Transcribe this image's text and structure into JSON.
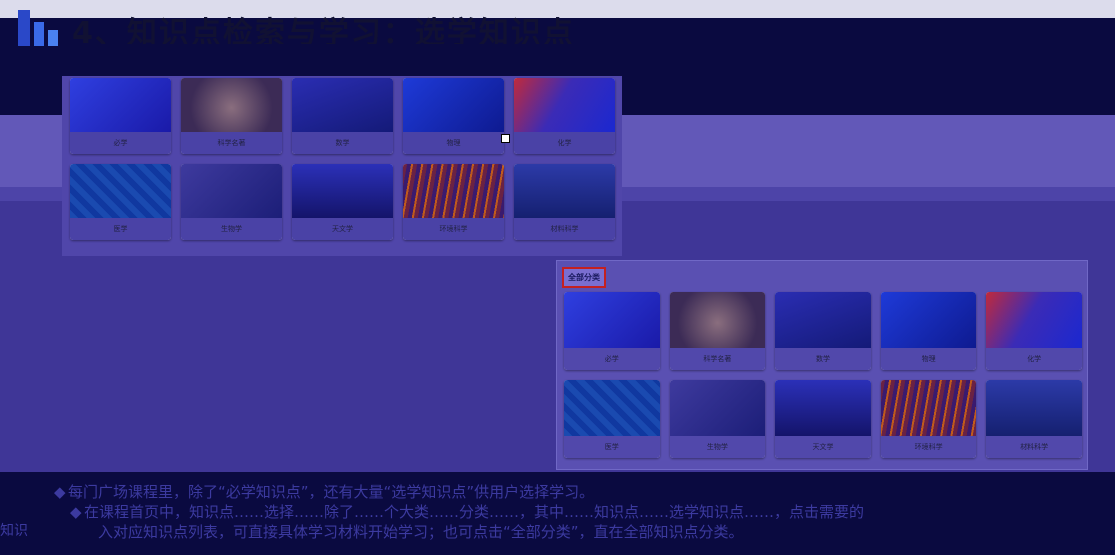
{
  "slide": {
    "title": "4、知识点检索与学习：选学知识点",
    "section_label": "全部分类",
    "side_text": "知识"
  },
  "top_grid": {
    "row1": [
      "必学",
      "科学名著",
      "数学",
      "物理",
      "化学"
    ],
    "row2": [
      "医学",
      "生物学",
      "天文学",
      "环境科学",
      "材料科学"
    ]
  },
  "right_grid": {
    "row1": [
      "必学",
      "科学名著",
      "数学",
      "物理",
      "化学"
    ],
    "row2": [
      "医学",
      "生物学",
      "天文学",
      "环境科学",
      "材料科学"
    ]
  },
  "notes": [
    "每门广场课程里，除了“必学知识点”，还有大量“选学知识点”供用户选择学习。",
    "在课程首页中，知识点……选择……除了……个大类……分类……，其中……知识点……选学知识点……，点击需要的",
    "入对应知识点列表，可直接具体学习材料开始学习；也可点击“全部分类”，直在全部知识点分类。"
  ],
  "colors": {
    "accent_red": "#c42020",
    "brand_blue": "#2a48c8",
    "background": "#3f3697"
  }
}
